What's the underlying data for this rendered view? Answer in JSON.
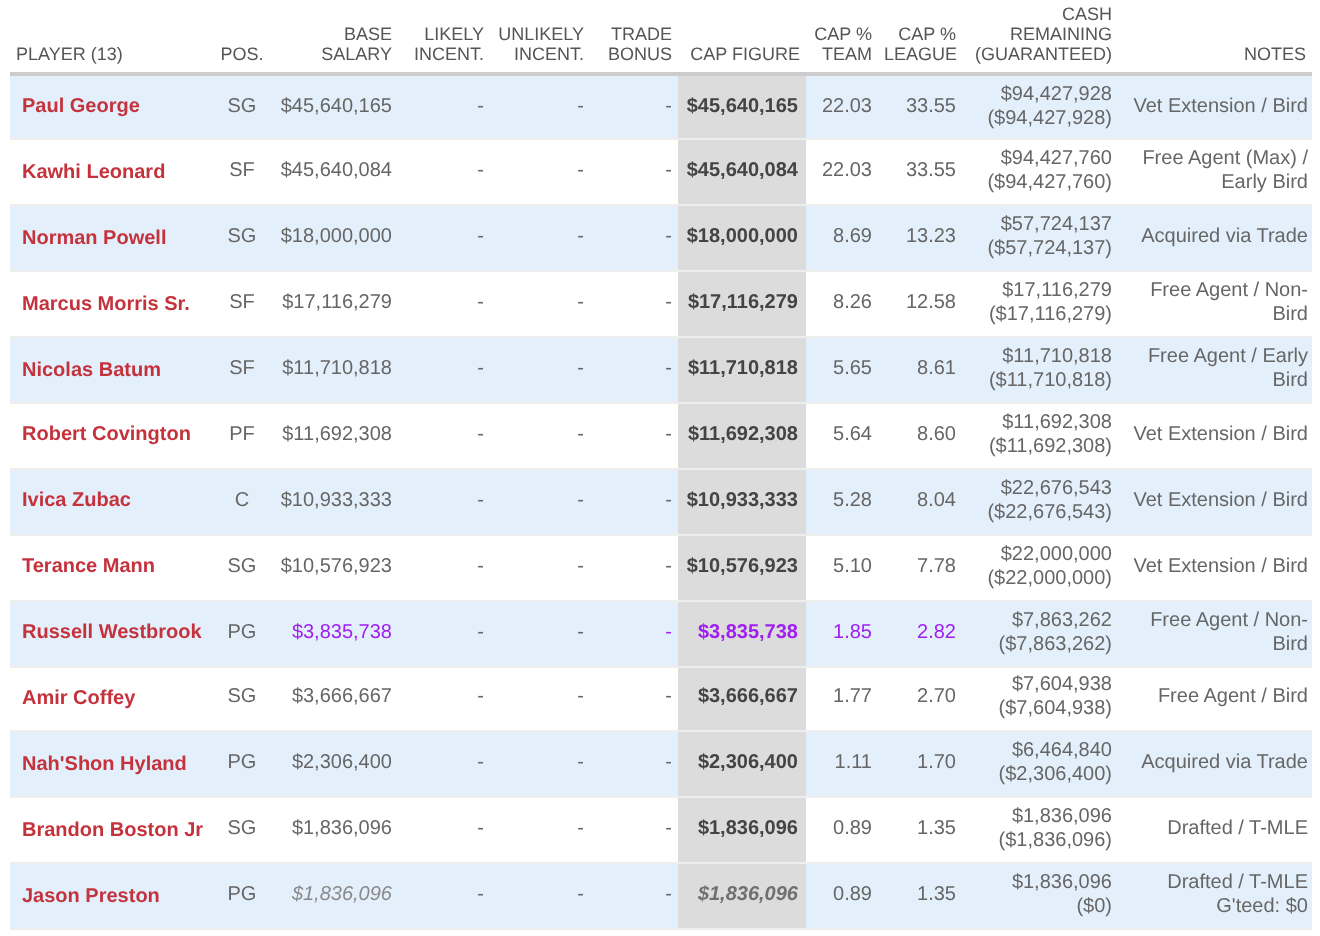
{
  "table": {
    "columns": [
      {
        "label": "PLAYER (13)"
      },
      {
        "label": "POS."
      },
      {
        "label": "BASE SALARY"
      },
      {
        "label": "LIKELY INCENT."
      },
      {
        "label": "UNLIKELY INCENT."
      },
      {
        "label": "TRADE BONUS"
      },
      {
        "label": "CAP FIGURE"
      },
      {
        "label": "CAP % TEAM"
      },
      {
        "label": "CAP % LEAGUE"
      },
      {
        "label": "CASH REMAINING (GUARANTEED)"
      },
      {
        "label": "NOTES"
      }
    ],
    "rows": [
      {
        "kind": "standard",
        "player": "Paul George",
        "pos": "SG",
        "base": "$45,640,165",
        "likely": "-",
        "unlikely": "-",
        "trade": "-",
        "cap": "$45,640,165",
        "team": "22.03",
        "league": "33.55",
        "cash": "$94,427,928",
        "guaranteed": "($94,427,928)",
        "notes": "Vet Extension / Bird"
      },
      {
        "kind": "standard",
        "player": "Kawhi Leonard",
        "pos": "SF",
        "base": "$45,640,084",
        "likely": "-",
        "unlikely": "-",
        "trade": "-",
        "cap": "$45,640,084",
        "team": "22.03",
        "league": "33.55",
        "cash": "$94,427,760",
        "guaranteed": "($94,427,760)",
        "notes": "Free Agent (Max) / Early Bird"
      },
      {
        "kind": "standard",
        "player": "Norman Powell",
        "pos": "SG",
        "base": "$18,000,000",
        "likely": "-",
        "unlikely": "-",
        "trade": "-",
        "cap": "$18,000,000",
        "team": "8.69",
        "league": "13.23",
        "cash": "$57,724,137",
        "guaranteed": "($57,724,137)",
        "notes": "Acquired via Trade"
      },
      {
        "kind": "standard",
        "player": "Marcus Morris Sr.",
        "pos": "SF",
        "base": "$17,116,279",
        "likely": "-",
        "unlikely": "-",
        "trade": "-",
        "cap": "$17,116,279",
        "team": "8.26",
        "league": "12.58",
        "cash": "$17,116,279",
        "guaranteed": "($17,116,279)",
        "notes": "Free Agent / Non-Bird"
      },
      {
        "kind": "standard",
        "player": "Nicolas Batum",
        "pos": "SF",
        "base": "$11,710,818",
        "likely": "-",
        "unlikely": "-",
        "trade": "-",
        "cap": "$11,710,818",
        "team": "5.65",
        "league": "8.61",
        "cash": "$11,710,818",
        "guaranteed": "($11,710,818)",
        "notes": "Free Agent / Early Bird"
      },
      {
        "kind": "standard",
        "player": "Robert Covington",
        "pos": "PF",
        "base": "$11,692,308",
        "likely": "-",
        "unlikely": "-",
        "trade": "-",
        "cap": "$11,692,308",
        "team": "5.64",
        "league": "8.60",
        "cash": "$11,692,308",
        "guaranteed": "($11,692,308)",
        "notes": "Vet Extension / Bird"
      },
      {
        "kind": "standard",
        "player": "Ivica Zubac",
        "pos": "C",
        "base": "$10,933,333",
        "likely": "-",
        "unlikely": "-",
        "trade": "-",
        "cap": "$10,933,333",
        "team": "5.28",
        "league": "8.04",
        "cash": "$22,676,543",
        "guaranteed": "($22,676,543)",
        "notes": "Vet Extension / Bird"
      },
      {
        "kind": "standard",
        "player": "Terance Mann",
        "pos": "SG",
        "base": "$10,576,923",
        "likely": "-",
        "unlikely": "-",
        "trade": "-",
        "cap": "$10,576,923",
        "team": "5.10",
        "league": "7.78",
        "cash": "$22,000,000",
        "guaranteed": "($22,000,000)",
        "notes": "Vet Extension / Bird"
      },
      {
        "kind": "highlighted",
        "player": "Russell Westbrook",
        "pos": "PG",
        "base": "$3,835,738",
        "likely": "-",
        "unlikely": "-",
        "trade": "-",
        "cap": "$3,835,738",
        "team": "1.85",
        "league": "2.82",
        "cash": "$7,863,262",
        "guaranteed": "($7,863,262)",
        "notes": "Free Agent / Non-Bird"
      },
      {
        "kind": "standard",
        "player": "Amir Coffey",
        "pos": "SG",
        "base": "$3,666,667",
        "likely": "-",
        "unlikely": "-",
        "trade": "-",
        "cap": "$3,666,667",
        "team": "1.77",
        "league": "2.70",
        "cash": "$7,604,938",
        "guaranteed": "($7,604,938)",
        "notes": "Free Agent / Bird"
      },
      {
        "kind": "standard",
        "player": "Nah'Shon Hyland",
        "pos": "PG",
        "base": "$2,306,400",
        "likely": "-",
        "unlikely": "-",
        "trade": "-",
        "cap": "$2,306,400",
        "team": "1.11",
        "league": "1.70",
        "cash": "$6,464,840",
        "guaranteed": "($2,306,400)",
        "notes": "Acquired via Trade"
      },
      {
        "kind": "standard",
        "player": "Brandon Boston Jr",
        "pos": "SG",
        "base": "$1,836,096",
        "likely": "-",
        "unlikely": "-",
        "trade": "-",
        "cap": "$1,836,096",
        "team": "0.89",
        "league": "1.35",
        "cash": "$1,836,096",
        "guaranteed": "($1,836,096)",
        "notes": "Drafted / T-MLE"
      },
      {
        "kind": "non_guaranteed",
        "player": "Jason Preston",
        "pos": "PG",
        "base": "$1,836,096",
        "likely": "-",
        "unlikely": "-",
        "trade": "-",
        "cap": "$1,836,096",
        "team": "0.89",
        "league": "1.35",
        "cash": "$1,836,096",
        "guaranteed": "($0)",
        "notes": "Drafted / T-MLE\nG'teed: $0"
      }
    ]
  }
}
